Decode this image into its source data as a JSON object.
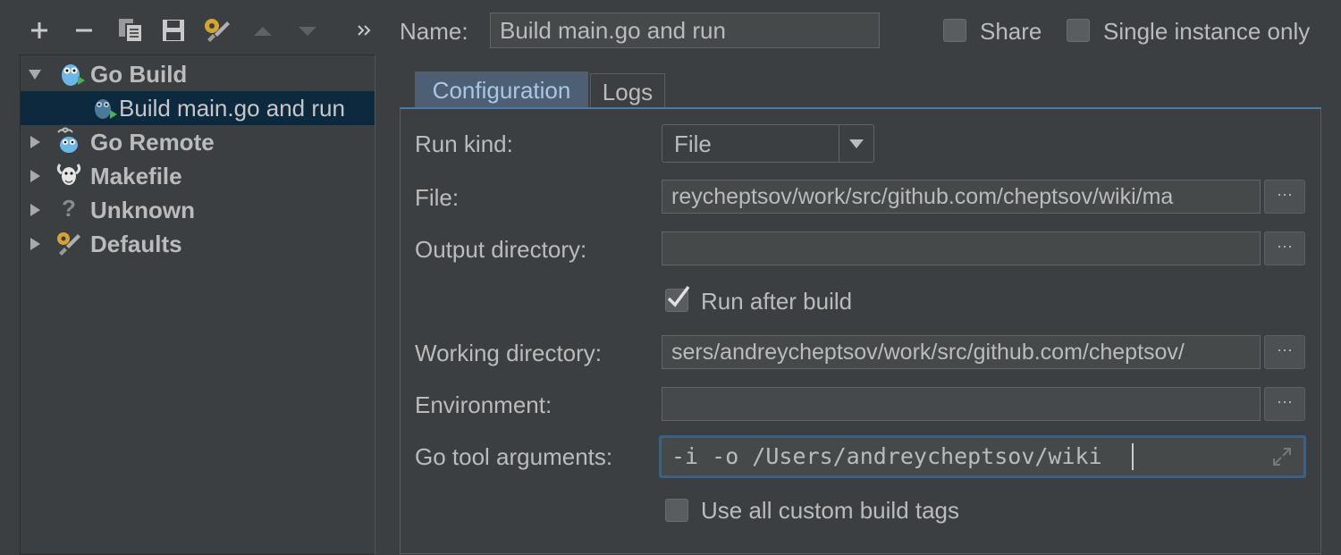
{
  "toolbar": {
    "items": [
      {
        "name": "add-icon"
      },
      {
        "name": "remove-icon"
      },
      {
        "name": "copy-icon"
      },
      {
        "name": "save-icon"
      },
      {
        "name": "edit-defaults-icon"
      },
      {
        "name": "move-up-icon"
      },
      {
        "name": "move-down-icon"
      },
      {
        "name": "more-icon"
      }
    ]
  },
  "tree": {
    "items": [
      {
        "label": "Go Build",
        "expanded": true,
        "bold": true
      },
      {
        "label": "Build main.go and run",
        "selected": true
      },
      {
        "label": "Go Remote",
        "expanded": false,
        "bold": true
      },
      {
        "label": "Makefile",
        "expanded": false,
        "bold": true
      },
      {
        "label": "Unknown",
        "expanded": false,
        "bold": true
      },
      {
        "label": "Defaults",
        "expanded": false,
        "bold": true
      }
    ]
  },
  "header": {
    "name_label": "Name:",
    "name_value": "Build main.go and run",
    "share_label": "Share",
    "single_instance_label": "Single instance only"
  },
  "tabs": [
    {
      "label": "Configuration",
      "active": true
    },
    {
      "label": "Logs",
      "active": false
    }
  ],
  "form": {
    "run_kind_label": "Run kind:",
    "run_kind_value": "File",
    "file_label": "File:",
    "file_value": "reycheptsov/work/src/github.com/cheptsov/wiki/ma",
    "output_label": "Output directory:",
    "output_value": "",
    "run_after_build_label": "Run after build",
    "run_after_build_checked": true,
    "working_dir_label": "Working directory:",
    "working_dir_value": "sers/andreycheptsov/work/src/github.com/cheptsov/",
    "environment_label": "Environment:",
    "environment_value": "",
    "go_tool_args_label": "Go tool arguments:",
    "go_tool_args_value": "-i -o /Users/andreycheptsov/wiki",
    "custom_tags_label": "Use all custom build tags",
    "browse_glyph": "···"
  },
  "colors": {
    "background": "#3c3f41",
    "selection": "#0d293e",
    "accent": "#4a78a8",
    "tab_active": "#4e5f74"
  }
}
